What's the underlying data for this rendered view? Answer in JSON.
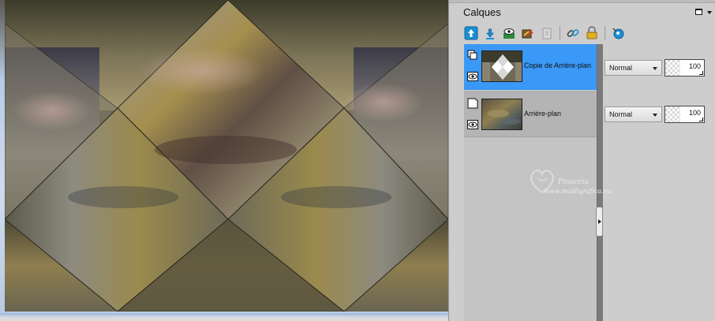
{
  "canvas": {
    "image_description_icon": "kaleidoscope-artwork-image"
  },
  "palette": {
    "title": "Calques",
    "toolbar_icons": [
      "move-layer-up-icon",
      "move-layer-down-icon",
      "layer-visibility-icon",
      "edit-layer-icon",
      "delete-layer-icon",
      "link-layers-icon",
      "lock-layer-icon",
      "layer-properties-icon"
    ],
    "layers": [
      {
        "name": "Copie de Arrière-plan",
        "blend_mode": "Normal",
        "opacity": "100",
        "selected": true
      },
      {
        "name": "Arrière-plan",
        "blend_mode": "Normal",
        "opacity": "100",
        "selected": false
      }
    ],
    "watermark": {
      "title": "Pinuccia",
      "url": "www.maldigrafica.eu"
    }
  },
  "colors": {
    "selection": "#3a98f6",
    "panel_bg": "#cdcdcd",
    "accent_blue": "#1a8fd6"
  }
}
